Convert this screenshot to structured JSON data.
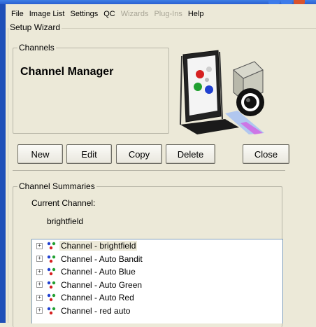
{
  "menu": {
    "items": [
      {
        "label": "File",
        "enabled": true
      },
      {
        "label": "Image List",
        "enabled": true
      },
      {
        "label": "Settings",
        "enabled": true
      },
      {
        "label": "QC",
        "enabled": true
      },
      {
        "label": "Wizards",
        "enabled": false
      },
      {
        "label": "Plug-Ins",
        "enabled": false
      },
      {
        "label": "Help",
        "enabled": true
      }
    ]
  },
  "setup": {
    "title": "Setup Wizard"
  },
  "channels_group": {
    "legend": "Channels",
    "heading": "Channel Manager",
    "illustration": "microscope-camera-icon"
  },
  "buttons": {
    "new": "New",
    "edit": "Edit",
    "copy": "Copy",
    "delete": "Delete",
    "close": "Close"
  },
  "summaries": {
    "legend": "Channel Summaries",
    "current_label": "Current Channel:",
    "current_value": "brightfield",
    "tree": [
      {
        "label": "Channel - brightfield",
        "selected": true
      },
      {
        "label": "Channel - Auto Bandit",
        "selected": false
      },
      {
        "label": "Channel - Auto Blue",
        "selected": false
      },
      {
        "label": "Channel - Auto Green",
        "selected": false
      },
      {
        "label": "Channel - Auto Red",
        "selected": false
      },
      {
        "label": "Channel - red auto",
        "selected": false
      }
    ]
  },
  "colors": {
    "window_bg": "#ece9d8",
    "title_blue": "#2a5fd0",
    "dot_red": "#d62020",
    "dot_green": "#20a030",
    "dot_blue": "#2040d0"
  }
}
